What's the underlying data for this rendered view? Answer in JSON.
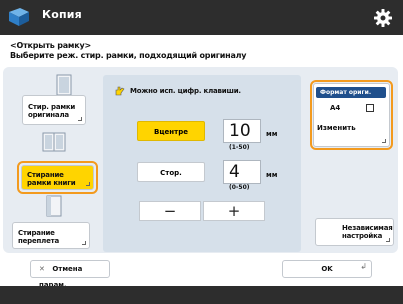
{
  "header": {
    "title": "Копия"
  },
  "instruction": {
    "line1": "<Открыть рамку>",
    "line2": "Выберите реж. стир. рамки, подходящий оригиналу"
  },
  "modes": [
    {
      "label1": "Стир. рамки",
      "label2": "оригинала"
    },
    {
      "label1": "Стирание",
      "label2": "рамки книги"
    },
    {
      "label1": "Стирание",
      "label2": "переплета"
    }
  ],
  "spin": {
    "header": "Можно исп. цифр. клавиши.",
    "center_label": "Вцентре",
    "center_value": "10",
    "center_unit": "мм",
    "center_range": "(1-50)",
    "side_label": "Стор.",
    "side_value": "4",
    "side_unit": "мм",
    "side_range": "(0-50)",
    "minus": "−",
    "plus": "+"
  },
  "format": {
    "header": "Формат ориги.",
    "value": "A4",
    "change_label": "Изменить"
  },
  "individual": {
    "label1": "Независимая",
    "label2": "настройка"
  },
  "footer": {
    "cancel_label": "Отмена парам.",
    "ok_label": "OK"
  },
  "colors": {
    "accent": "#ffd400",
    "selection": "#f39a1e",
    "header_blue": "#1f4f8c",
    "bar": "#2d2d2d"
  }
}
